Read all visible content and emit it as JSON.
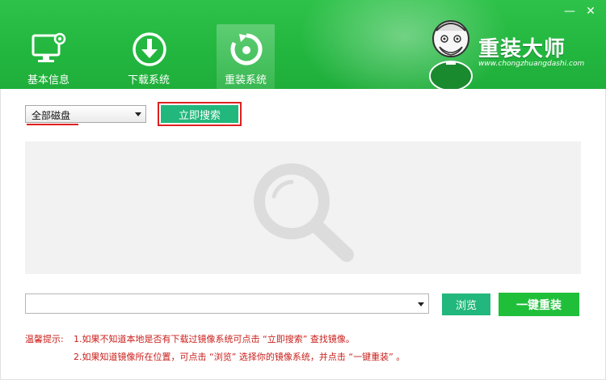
{
  "window": {
    "minimize_glyph": "—",
    "close_glyph": "✕"
  },
  "nav": {
    "tabs": [
      {
        "label": "基本信息",
        "icon": "monitor-gear-icon",
        "active": false
      },
      {
        "label": "下载系统",
        "icon": "download-arrow-icon",
        "active": false
      },
      {
        "label": "重装系统",
        "icon": "reinstall-disc-icon",
        "active": true
      }
    ]
  },
  "brand": {
    "name": "重装大师",
    "site": "www.chongzhuangdashi.com"
  },
  "search": {
    "disk_selected": "全部磁盘",
    "button_label": "立即搜索"
  },
  "actions": {
    "browse_label": "浏览",
    "oneclick_label": "一键重装"
  },
  "tips": {
    "label": "温馨提示:",
    "line1": "1.如果不知道本地是否有下载过镜像系统可点击 “立即搜索” 查找镜像。",
    "line2": "2.如果知道镜像所在位置，可点击 “浏览” 选择你的镜像系统，并点击 “一键重装” 。"
  },
  "colors": {
    "header_green": "#22b63f",
    "button_teal": "#22b77c",
    "button_green": "#1fbf3a",
    "highlight_red": "#e02020",
    "tip_red": "#c9201c"
  }
}
